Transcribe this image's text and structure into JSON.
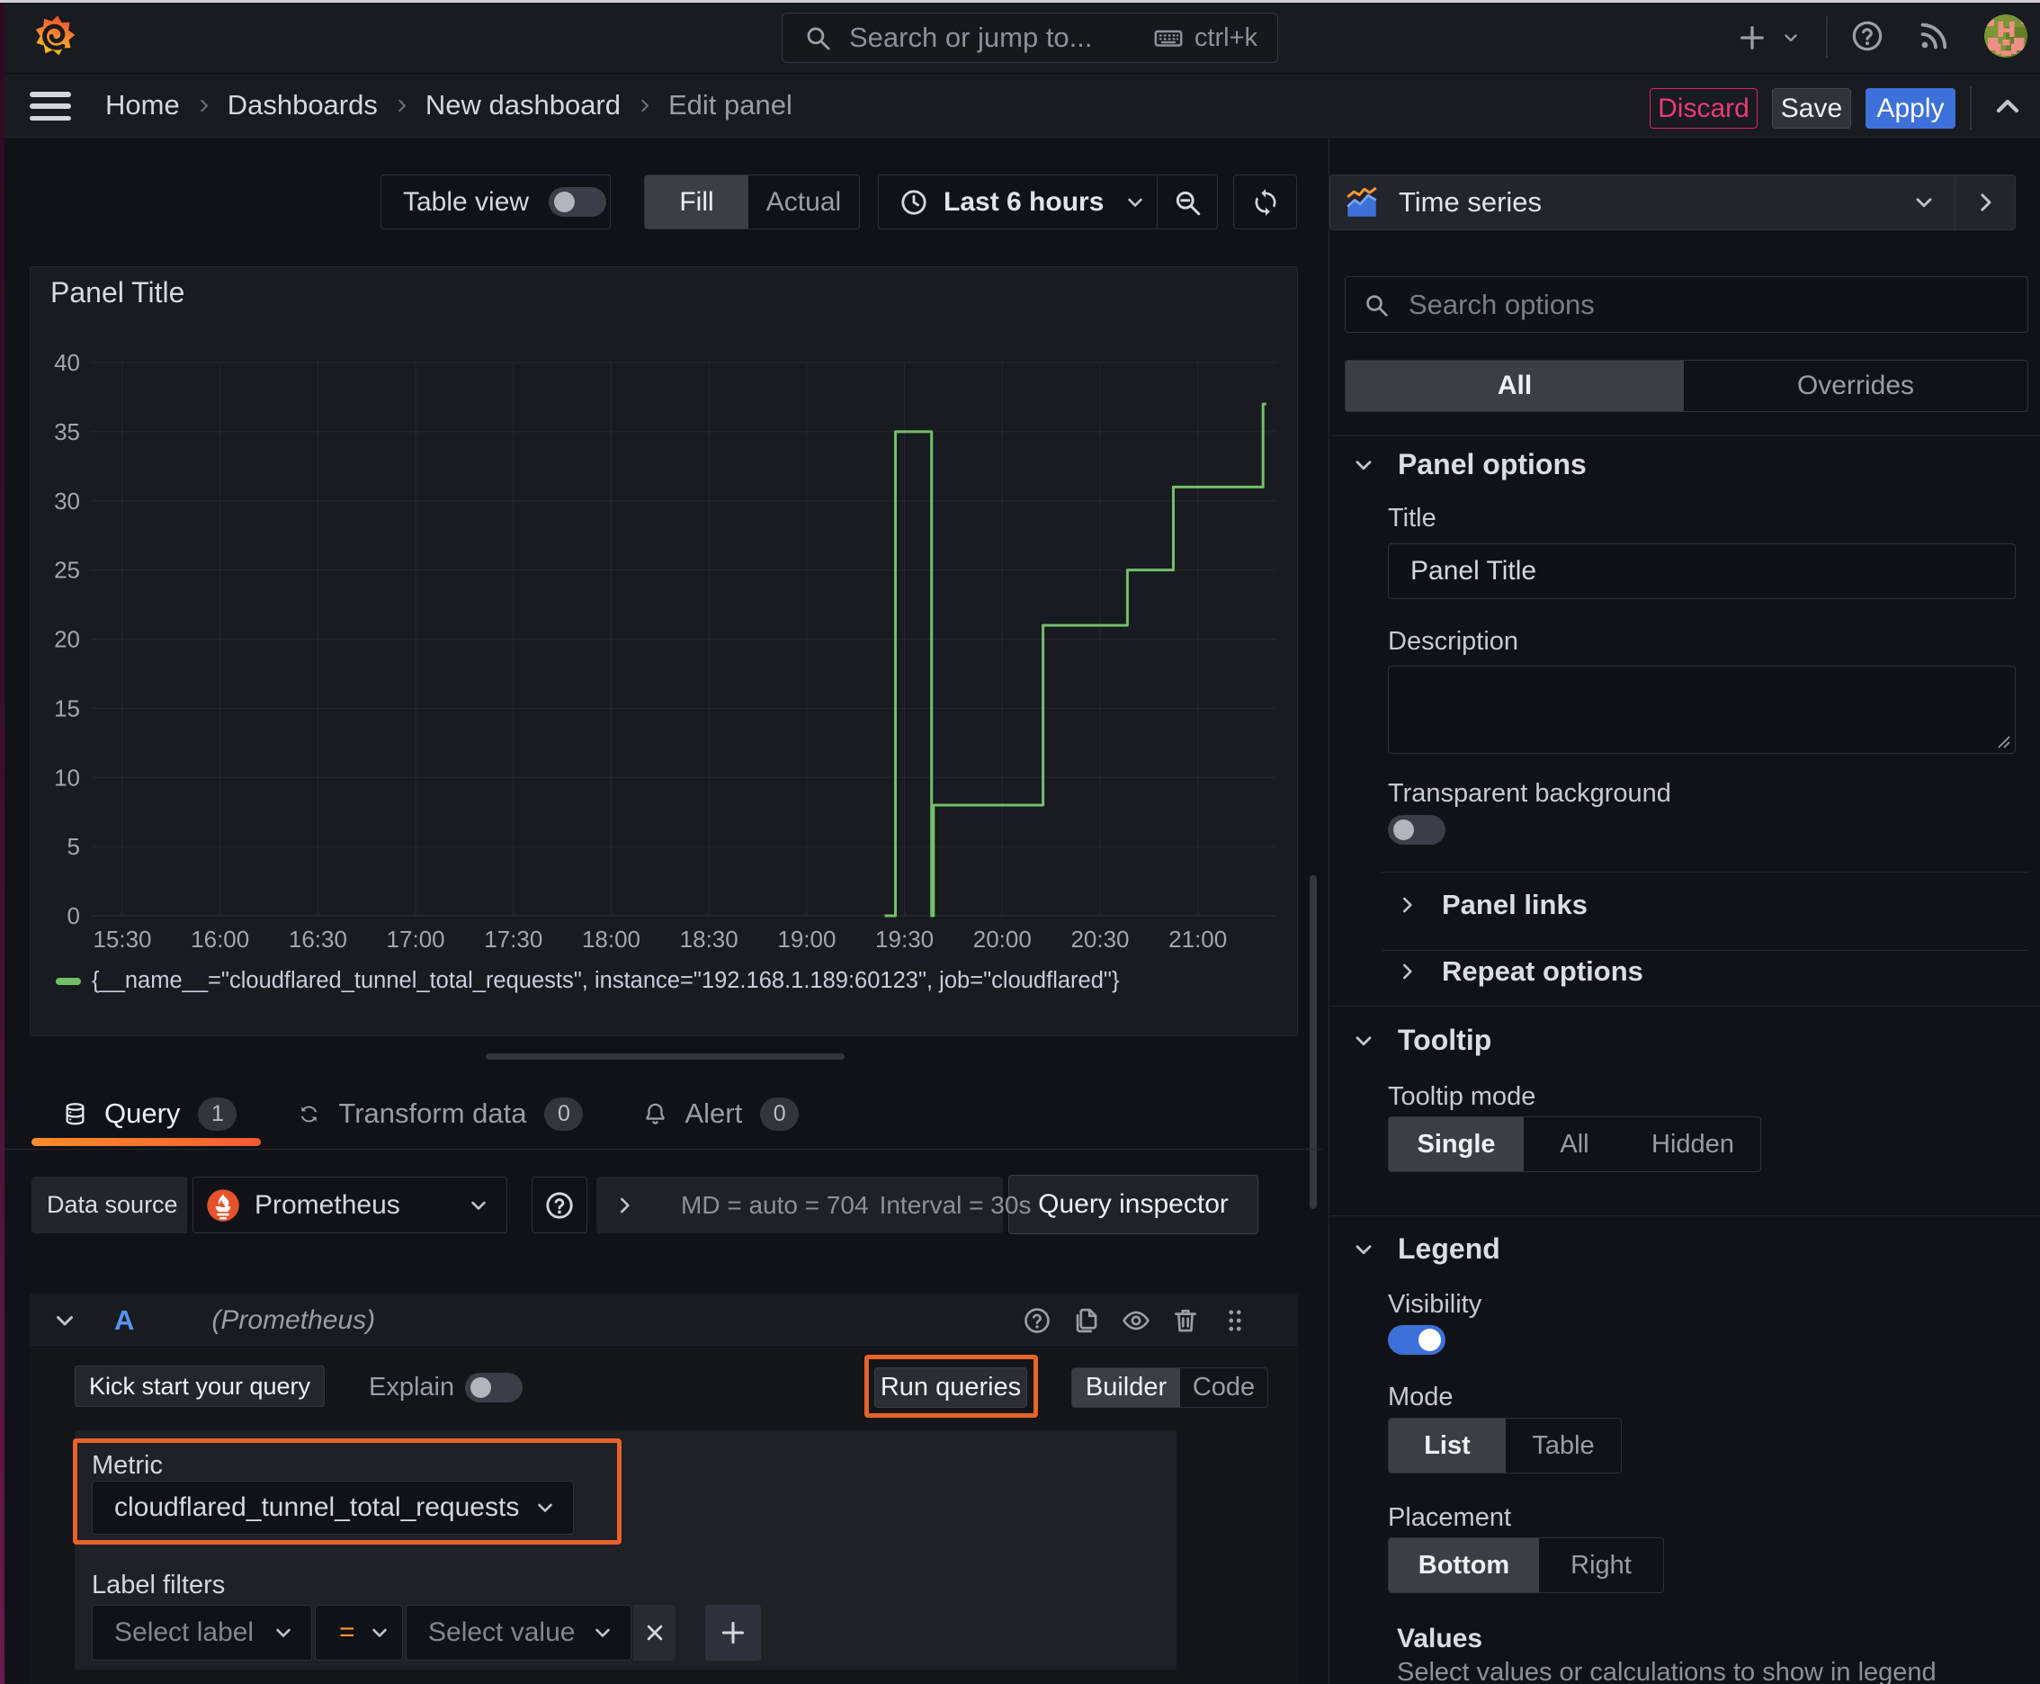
{
  "window": {
    "title": "Grafana - Edit panel"
  },
  "topbar": {
    "search_placeholder": "Search or jump to...",
    "shortcut": "ctrl+k"
  },
  "breadcrumb": {
    "items": [
      "Home",
      "Dashboards",
      "New dashboard",
      "Edit panel"
    ]
  },
  "header_actions": {
    "discard": "Discard",
    "save": "Save",
    "apply": "Apply"
  },
  "toolbar": {
    "table_view_label": "Table view",
    "fill": "Fill",
    "actual": "Actual",
    "time_range": "Last 6 hours"
  },
  "viz_picker": {
    "label": "Time series"
  },
  "panel": {
    "title": "Panel Title"
  },
  "chart_data": {
    "type": "line",
    "step": true,
    "title": "Panel Title",
    "x_ticks": [
      "15:30",
      "16:00",
      "16:30",
      "17:00",
      "17:30",
      "18:00",
      "18:30",
      "19:00",
      "19:30",
      "20:00",
      "20:30",
      "21:00"
    ],
    "x_tick_minutes": [
      0,
      30,
      60,
      90,
      120,
      150,
      180,
      210,
      240,
      270,
      300,
      330
    ],
    "x_axis_origin": "15:30",
    "x_domain_minutes": [
      -9.7,
      354.6
    ],
    "y_ticks": [
      0,
      5,
      10,
      15,
      20,
      25,
      30,
      35,
      40
    ],
    "ylim": [
      0,
      40
    ],
    "grid": true,
    "legend_position": "bottom",
    "series": [
      {
        "name": "{__name__=\"cloudflared_tunnel_total_requests\", instance=\"192.168.1.189:60123\", job=\"cloudflared\"}",
        "color": "#73bf69",
        "points_minutes_value": [
          [
            233.9,
            0
          ],
          [
            237.2,
            35
          ],
          [
            248.3,
            0
          ],
          [
            248.9,
            8
          ],
          [
            282.5,
            21
          ],
          [
            308.4,
            25
          ],
          [
            322.5,
            31
          ],
          [
            350,
            37
          ]
        ],
        "end_minute": 351
      }
    ]
  },
  "query_tabs": [
    {
      "label": "Query",
      "count": "1"
    },
    {
      "label": "Transform data",
      "count": "0"
    },
    {
      "label": "Alert",
      "count": "0"
    }
  ],
  "datasource_row": {
    "label": "Data source",
    "value": "Prometheus",
    "stat_md": "MD = auto = 704",
    "stat_interval": "Interval = 30s",
    "inspector": "Query inspector"
  },
  "query_row": {
    "ref_id": "A",
    "ds_hint": "(Prometheus)",
    "kickstart": "Kick start your query",
    "explain": "Explain",
    "run": "Run queries",
    "builder": "Builder",
    "code": "Code",
    "metric_label": "Metric",
    "metric_value": "cloudflared_tunnel_total_requests",
    "label_filters": "Label filters",
    "select_label_placeholder": "Select label",
    "operator": "=",
    "select_value_placeholder": "Select value"
  },
  "sidebar": {
    "search_placeholder": "Search options",
    "tabs": {
      "all": "All",
      "overrides": "Overrides"
    },
    "panel_options": {
      "heading": "Panel options",
      "title_label": "Title",
      "title_value": "Panel Title",
      "description_label": "Description",
      "transparent_label": "Transparent background",
      "panel_links": "Panel links",
      "repeat_options": "Repeat options"
    },
    "tooltip": {
      "heading": "Tooltip",
      "mode_label": "Tooltip mode",
      "options": {
        "single": "Single",
        "all": "All",
        "hidden": "Hidden"
      },
      "selected": "Single"
    },
    "legend": {
      "heading": "Legend",
      "visibility_label": "Visibility",
      "visibility_on": true,
      "mode_label": "Mode",
      "mode_options": {
        "list": "List",
        "table": "Table"
      },
      "mode_selected": "List",
      "placement_label": "Placement",
      "placement_options": {
        "bottom": "Bottom",
        "right": "Right"
      },
      "placement_selected": "Bottom",
      "values_label": "Values",
      "values_help": "Select values or calculations to show in legend"
    }
  },
  "colors": {
    "page_bg": "#111217",
    "panel_bg": "#181b1f",
    "accent_blue": "#3d71d9",
    "discard_red": "#e0226e",
    "series_green": "#73bf69",
    "annotation_orange": "#e8622c",
    "tab_underline": "#ff780a",
    "prometheus_orange": "#e6522c",
    "operator_orange": "#ff9830"
  }
}
